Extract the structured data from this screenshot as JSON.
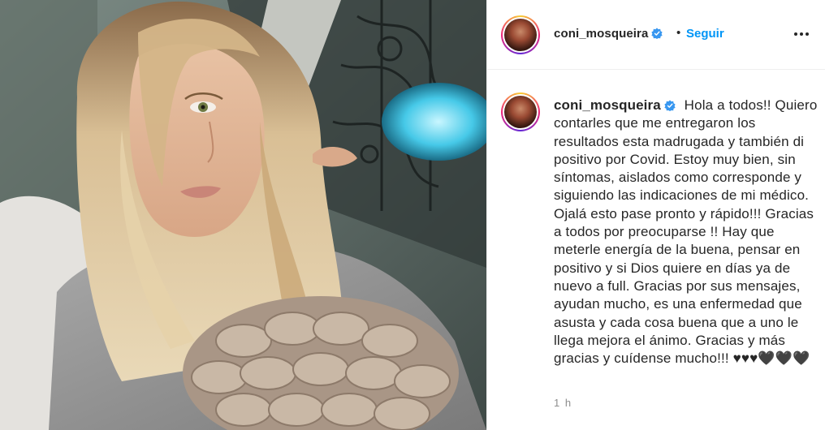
{
  "post": {
    "username": "coni_mosqueira",
    "verified": true,
    "follow_label": "Seguir",
    "separator": "•",
    "caption": "Hola a todos!! Quiero contarles que me entregaron los resultados esta madrugada y también di positivo por Covid. Estoy muy bien, sin síntomas, aislados como corresponde y siguiendo las indicaciones de mi médico. Ojalá esto pase pronto y rápido!!! Gracias a todos por preocuparse !! Hay que meterle energía de la buena, pensar en positivo y si Dios quiere en días ya de nuevo a full. Gracias por sus mensajes, ayudan mucho, es una enfermedad que asusta y cada cosa buena que a uno le llega mejora el ánimo. Gracias y más gracias y cuídense mucho!!! ♥♥♥🖤🖤🖤",
    "time_ago": "1 h"
  },
  "icons": {
    "verified": "verified-badge-icon",
    "more": "more-options-icon"
  },
  "colors": {
    "accent": "#0095f6",
    "text": "#262626",
    "muted": "#8e8e8e",
    "border": "#efefef"
  }
}
